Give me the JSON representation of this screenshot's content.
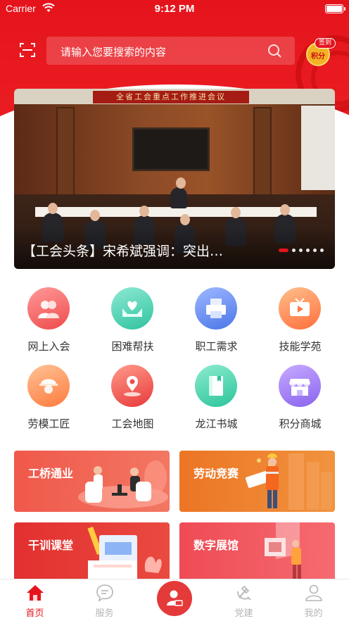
{
  "status_bar": {
    "carrier": "Carrier",
    "time": "9:12 PM"
  },
  "search": {
    "placeholder": "请输入您要搜索的内容"
  },
  "points": {
    "signin": "签到",
    "label": "积分"
  },
  "banner": {
    "sign_text": "全省工会重点工作推进会议",
    "title": "【工会头条】宋希斌强调：突出…",
    "dots": 6,
    "active_dot": 0
  },
  "grid": {
    "items": [
      {
        "label": "网上入会",
        "icon": "join-union-icon",
        "color": "#f26a6a"
      },
      {
        "label": "困难帮扶",
        "icon": "helping-hands-icon",
        "color": "#4ecfb4"
      },
      {
        "label": "职工需求",
        "icon": "printer-icon",
        "color": "#5b87f0"
      },
      {
        "label": "技能学苑",
        "icon": "tv-play-icon",
        "color": "#ff8a4c"
      },
      {
        "label": "劳模工匠",
        "icon": "worker-helmet-icon",
        "color": "#ff8e56"
      },
      {
        "label": "工会地图",
        "icon": "map-pin-icon",
        "color": "#f25c5c"
      },
      {
        "label": "龙江书城",
        "icon": "book-icon",
        "color": "#38cfa6"
      },
      {
        "label": "积分商城",
        "icon": "shop-icon",
        "color": "#9b76f3"
      }
    ]
  },
  "cards": [
    {
      "title": "工桥通业",
      "color": "#ef5b4d"
    },
    {
      "title": "劳动竞赛",
      "color": "#ee7d2b"
    },
    {
      "title": "干训课堂",
      "color": "#e4363a"
    },
    {
      "title": "数字展馆",
      "color": "#f1565e"
    }
  ],
  "tabbar": {
    "items": [
      {
        "label": "首页",
        "icon": "home-icon",
        "active": true
      },
      {
        "label": "服务",
        "icon": "service-chat-icon",
        "active": false
      },
      {
        "label": "",
        "icon": "user-center-icon",
        "active": false
      },
      {
        "label": "党建",
        "icon": "party-emblem-icon",
        "active": false
      },
      {
        "label": "我的",
        "icon": "profile-icon",
        "active": false
      }
    ]
  },
  "colors": {
    "primary": "#e5141c",
    "tab_inactive": "#b5b5b5"
  }
}
